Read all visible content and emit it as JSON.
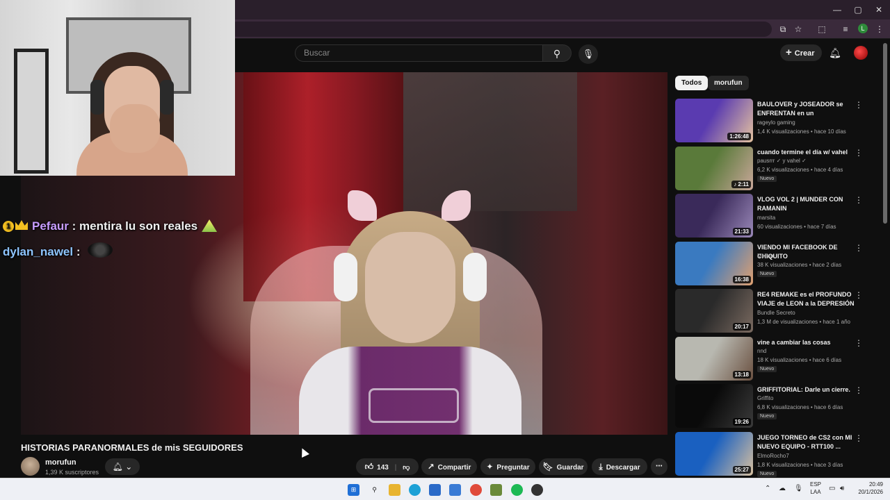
{
  "browser": {
    "window_controls": [
      "—",
      "▢",
      "✕"
    ]
  },
  "youtube": {
    "search_placeholder": "Buscar",
    "create_label": "Crear"
  },
  "stream_chat": [
    {
      "user": "Pefaur",
      "message": "mentira lu son reales",
      "user_color": "#c89cff"
    },
    {
      "user": "dylan_nawel",
      "message": "",
      "user_color": "#8ec5ff"
    }
  ],
  "video": {
    "title": "HISTORIAS PARANORMALES de mis SEGUIDORES",
    "channel": "morufun",
    "subscribers": "1,39 K suscriptores",
    "likes": "143",
    "share_label": "Compartir",
    "ask_label": "Preguntar",
    "save_label": "Guardar",
    "download_label": "Descargar"
  },
  "filters": [
    "Todos",
    "morufun"
  ],
  "recommendations": [
    {
      "title": "BAULOVER y JOSEADOR se ENFRENTAN en un SPEEDRUN...",
      "channel": "rageylo gaming",
      "meta": "1,4 K visualizaciones • hace 10 días",
      "duration": "1:26:48",
      "new": "",
      "colors": [
        "#5a3bb0",
        "#e5c3a0"
      ]
    },
    {
      "title": "cuando termine el día w/ vahel",
      "channel": "pausrrr ✓ y vahel ✓",
      "meta": "6,2 K visualizaciones • hace 4 días",
      "duration": "♪ 2:11",
      "new": "Nuevo",
      "colors": [
        "#5a7a3a",
        "#c9a79a"
      ]
    },
    {
      "title": "VLOG VOL 2 | MUNDER CON RAMANIN",
      "channel": "marsita",
      "meta": "60 visualizaciones • hace 7 días",
      "duration": "21:33",
      "new": "",
      "colors": [
        "#3a2a5a",
        "#9a88b8"
      ]
    },
    {
      "title": "VIENDO MI FACEBOOK DE CHIQUITO",
      "channel": "Melian",
      "meta": "38 K visualizaciones • hace 2 días",
      "duration": "16:38",
      "new": "Nuevo",
      "colors": [
        "#3a7ac0",
        "#e0a070"
      ]
    },
    {
      "title": "RE4 REMAKE es el PROFUNDO VIAJE de LEON a la DEPRESIÓN",
      "channel": "Bundle Secreto",
      "meta": "1,3 M de visualizaciones • hace 1 año",
      "duration": "20:17",
      "new": "",
      "colors": [
        "#2a2a2a",
        "#7a6a60"
      ]
    },
    {
      "title": "vine a cambiar las cosas",
      "channel": "nnd",
      "meta": "18 K visualizaciones • hace 6 días",
      "duration": "13:18",
      "new": "Nuevo",
      "colors": [
        "#b8b8b0",
        "#6a5040"
      ]
    },
    {
      "title": "GRIFFITORIAL: Darle un cierre.",
      "channel": "Griffito",
      "meta": "6,8 K visualizaciones • hace 6 días",
      "duration": "19:26",
      "new": "Nuevo",
      "colors": [
        "#0a0a0a",
        "#3a3a3a"
      ]
    },
    {
      "title": "JUEGO TORNEO de CS2 con MI NUEVO EQUIPO - RTT100 ...",
      "channel": "ElmoRocho7",
      "meta": "1,8 K visualizaciones • hace 3 días",
      "duration": "25:27",
      "new": "Nuevo",
      "colors": [
        "#1a60c0",
        "#d8c0a0"
      ]
    }
  ],
  "taskbar": {
    "lang_line1": "ESP",
    "lang_line2": "LAA",
    "time": "20:49",
    "date": "20/1/2026"
  }
}
